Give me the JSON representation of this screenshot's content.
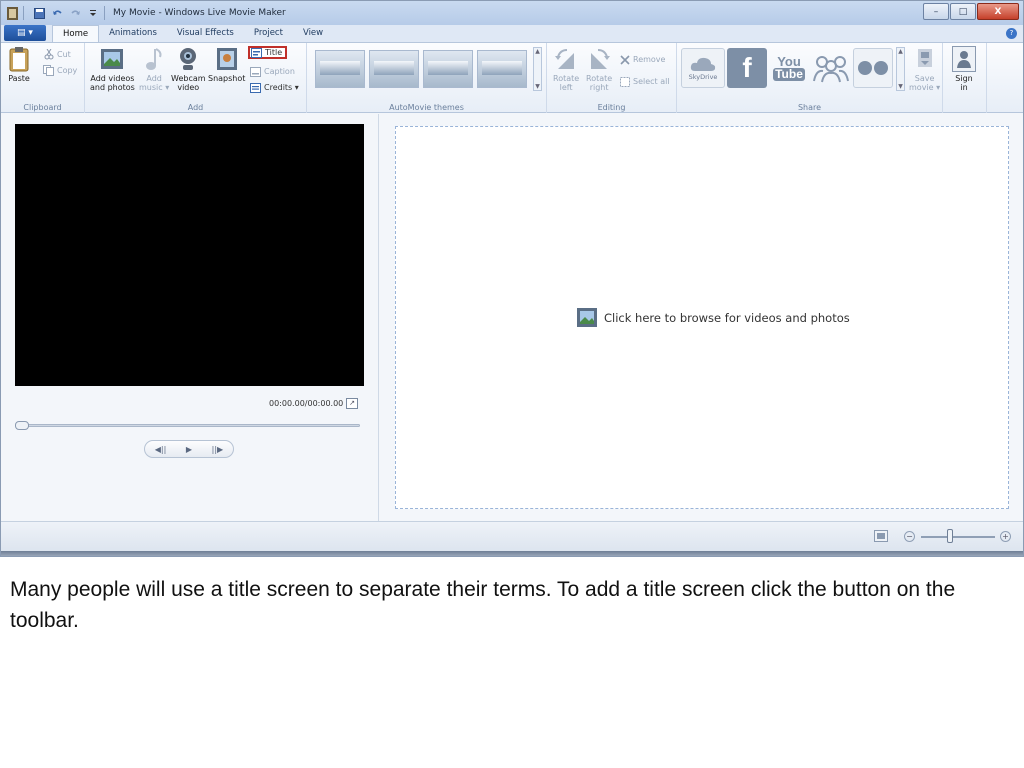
{
  "window": {
    "title": "My Movie - Windows Live Movie Maker",
    "controls": {
      "minimize": "–",
      "maximize": "□",
      "close": "X"
    }
  },
  "tabs": [
    {
      "label": "Home",
      "active": true
    },
    {
      "label": "Animations",
      "active": false
    },
    {
      "label": "Visual Effects",
      "active": false
    },
    {
      "label": "Project",
      "active": false
    },
    {
      "label": "View",
      "active": false
    }
  ],
  "app_menu_label": "▤ ▾",
  "help_label": "?",
  "ribbon": {
    "clipboard": {
      "label": "Clipboard",
      "paste": "Paste",
      "cut": "Cut",
      "copy": "Copy"
    },
    "add": {
      "label": "Add",
      "add_videos_line1": "Add videos",
      "add_videos_line2": "and photos",
      "add_music_line1": "Add",
      "add_music_line2": "music ▾",
      "webcam_line1": "Webcam",
      "webcam_line2": "video",
      "snapshot": "Snapshot",
      "title": "Title",
      "caption": "Caption",
      "credits": "Credits ▾"
    },
    "themes": {
      "label": "AutoMovie themes"
    },
    "editing": {
      "label": "Editing",
      "rotate_left_line1": "Rotate",
      "rotate_left_line2": "left",
      "rotate_right_line1": "Rotate",
      "rotate_right_line2": "right",
      "remove": "Remove",
      "select_all": "Select all"
    },
    "share": {
      "label": "Share",
      "skydrive": "SkyDrive",
      "facebook": "f",
      "youtube_line1": "You",
      "youtube_line2": "Tube",
      "save_movie_line1": "Save",
      "save_movie_line2": "movie ▾",
      "sign_in_line1": "Sign",
      "sign_in_line2": "in"
    }
  },
  "preview": {
    "time": "00:00.00/00:00.00",
    "buttons": {
      "prev": "◀||",
      "play": "▶",
      "next": "||▶"
    }
  },
  "storyboard": {
    "prompt": "Click here to browse for videos and photos"
  },
  "statusbar": {
    "zoom_out": "−",
    "zoom_in": "+"
  },
  "colors": {
    "accent": "#1e4f9a",
    "highlight_box": "#c0302a",
    "facebook": "#3b5998",
    "youtube": "#7d8fa6"
  },
  "caption": "Many people will use a title screen to separate their terms. To add a title screen click the button on the toolbar."
}
